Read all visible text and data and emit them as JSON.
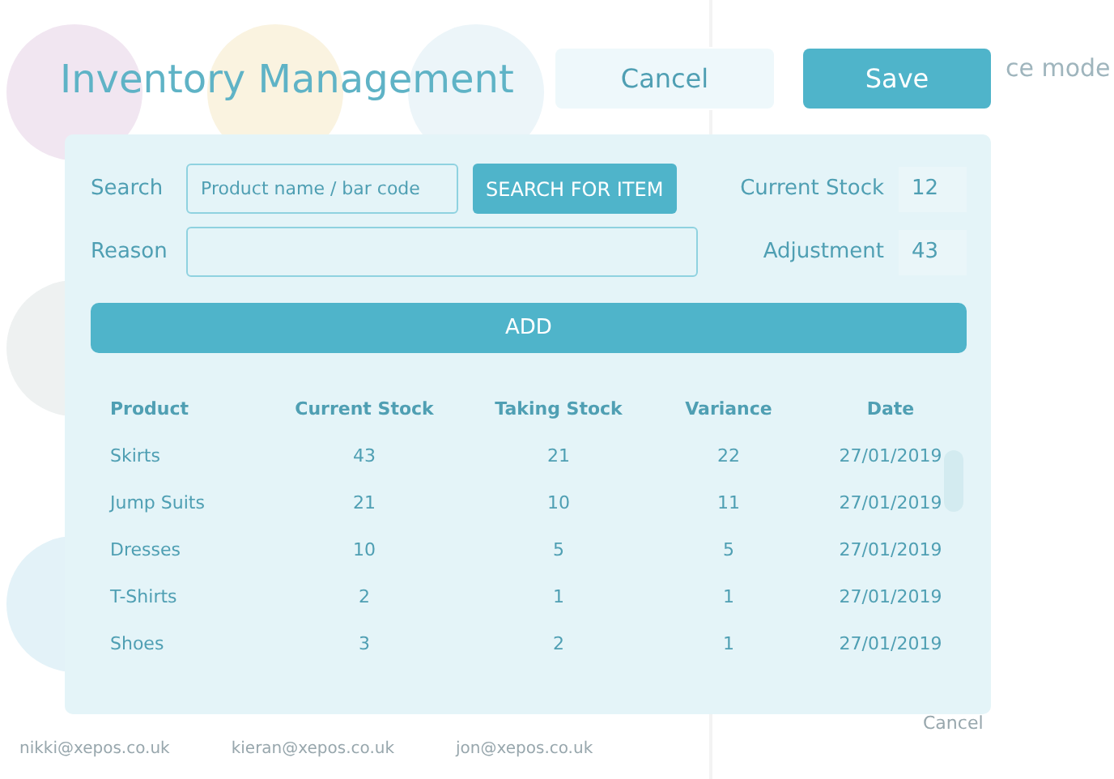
{
  "background": {
    "avatar_rows": [
      [
        {
          "color": "#f1e6f1"
        },
        {
          "color": "#faf3e0"
        },
        {
          "color": "#ecf5f9"
        }
      ],
      [
        {
          "color": "#eef1f1"
        }
      ],
      [
        {
          "color": "#e3f2f8"
        }
      ]
    ],
    "emails": [
      "nikki@xepos.co.uk",
      "kieran@xepos.co.uk",
      "jon@xepos.co.uk"
    ],
    "side_title": "ce mode",
    "side_cancel": "Cancel"
  },
  "title": "Inventory Management",
  "buttons": {
    "cancel": "Cancel",
    "save": "Save"
  },
  "form": {
    "search_label": "Search",
    "search_placeholder": "Product name / bar code",
    "search_button": "SEARCH FOR ITEM",
    "reason_label": "Reason",
    "current_stock_label": "Current Stock",
    "current_stock": "12",
    "adjustment_label": "Adjustment",
    "adjustment": "43",
    "add_button": "ADD"
  },
  "table": {
    "columns": [
      "Product",
      "Current Stock",
      "Taking Stock",
      "Variance",
      "Date"
    ],
    "rows": [
      [
        "Skirts",
        "43",
        "21",
        "22",
        "27/01/2019"
      ],
      [
        "Jump Suits",
        "21",
        "10",
        "11",
        "27/01/2019"
      ],
      [
        "Dresses",
        "10",
        "5",
        "5",
        "27/01/2019"
      ],
      [
        "T-Shirts",
        "2",
        "1",
        "1",
        "27/01/2019"
      ],
      [
        "Shoes",
        "3",
        "2",
        "1",
        "27/01/2019"
      ]
    ]
  }
}
